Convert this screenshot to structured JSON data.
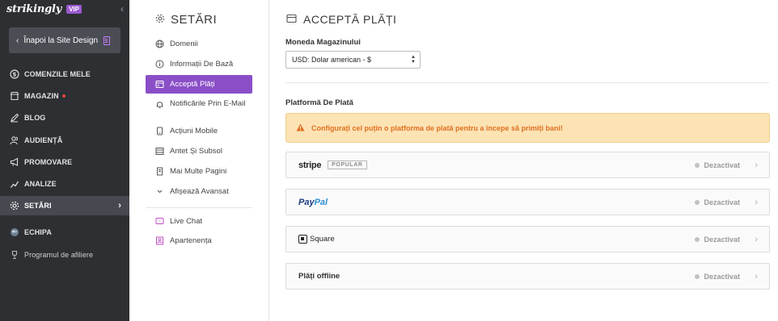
{
  "brand": {
    "logo": "strikingly",
    "badge": "VIP"
  },
  "back_button": {
    "label": "Înapoi la Site Design"
  },
  "sidebar": {
    "items": [
      {
        "label": "COMENZILE MELE",
        "icon": "dollar-circle-icon"
      },
      {
        "label": "MAGAZIN",
        "icon": "store-icon",
        "dot": true
      },
      {
        "label": "BLOG",
        "icon": "pen-icon"
      },
      {
        "label": "AUDIENȚĂ",
        "icon": "users-icon"
      },
      {
        "label": "PROMOVARE",
        "icon": "megaphone-icon"
      },
      {
        "label": "ANALIZE",
        "icon": "chart-icon"
      },
      {
        "label": "SETĂRI",
        "icon": "gear-icon",
        "active": true
      },
      {
        "label": "ECHIPA",
        "icon": "team-icon"
      },
      {
        "label": "Programul de afiliere",
        "icon": "trophy-icon"
      }
    ]
  },
  "settings": {
    "title": "SETĂRI",
    "items": [
      {
        "label": "Domenii",
        "icon": "globe-icon"
      },
      {
        "label": "Informații De Bază",
        "icon": "info-icon"
      },
      {
        "label": "Acceptă Plăți",
        "icon": "payment-icon",
        "active": true
      },
      {
        "label": "Notificările Prin E-Mail",
        "icon": "bell-icon"
      },
      {
        "label": "Acțiuni Mobile",
        "icon": "mobile-icon"
      },
      {
        "label": "Antet Și Subsol",
        "icon": "header-footer-icon"
      },
      {
        "label": "Mai Multe Pagini",
        "icon": "pages-icon"
      },
      {
        "label": "Afișează Avansat",
        "icon": "chevron-down-icon"
      },
      {
        "label": "Live Chat",
        "icon": "chat-icon"
      },
      {
        "label": "Apartenența",
        "icon": "membership-icon"
      }
    ]
  },
  "main": {
    "title": "ACCEPTĂ PLĂȚI",
    "currency_label": "Moneda Magazinului",
    "currency_value": "USD: Dolar american - $",
    "platform_label": "Platformă De Plată",
    "alert": "Configurați cel puțin o platforma de plată pentru a începe să primiți bani!",
    "providers": [
      {
        "name": "stripe",
        "badge": "POPULAR",
        "status": "Dezactivat"
      },
      {
        "name_a": "Pay",
        "name_b": "Pal",
        "status": "Dezactivat"
      },
      {
        "name": "Square",
        "status": "Dezactivat"
      },
      {
        "name": "Plăți offline",
        "status": "Dezactivat"
      }
    ]
  },
  "colors": {
    "accent": "#8a4fc7",
    "sidebar_bg": "#2d2f33",
    "alert_bg": "#fbe3b4",
    "alert_text": "#e0701f"
  }
}
